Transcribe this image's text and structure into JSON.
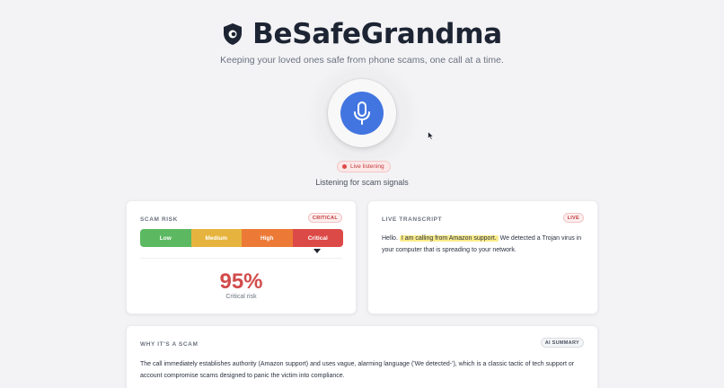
{
  "header": {
    "title": "BeSafeGrandma",
    "tagline": "Keeping your loved ones safe from phone scams, one call at a time."
  },
  "listening": {
    "pill": "Live listening",
    "status": "Listening for scam signals"
  },
  "risk_card": {
    "label": "SCAM RISK",
    "badge": "CRITICAL",
    "levels": [
      "Low",
      "Medium",
      "High",
      "Critical"
    ],
    "level_colors": [
      "#5cb961",
      "#e6b43e",
      "#ec7a36",
      "#dc4a48"
    ],
    "percent": "95%",
    "caption": "Critical risk"
  },
  "transcript_card": {
    "label": "LIVE TRANSCRIPT",
    "badge": "LIVE",
    "text_before": "Hello. ",
    "text_highlight": "I am calling from Amazon support.",
    "text_after": " We detected a Trojan virus in your computer that is spreading to your network."
  },
  "summary_card": {
    "label": "WHY IT'S A SCAM",
    "badge": "AI SUMMARY",
    "text": "The call immediately establishes authority (Amazon support) and uses vague, alarming language ('We detected-'), which is a classic tactic of tech support or account compromise scams designed to panic the victim into compliance."
  },
  "colors": {
    "accent": "#4275e0",
    "critical": "#d24b4b"
  },
  "icons": [
    "shield-logo-icon",
    "microphone-icon",
    "live-dot-icon",
    "pointer-cursor-icon",
    "risk-pointer-icon"
  ]
}
